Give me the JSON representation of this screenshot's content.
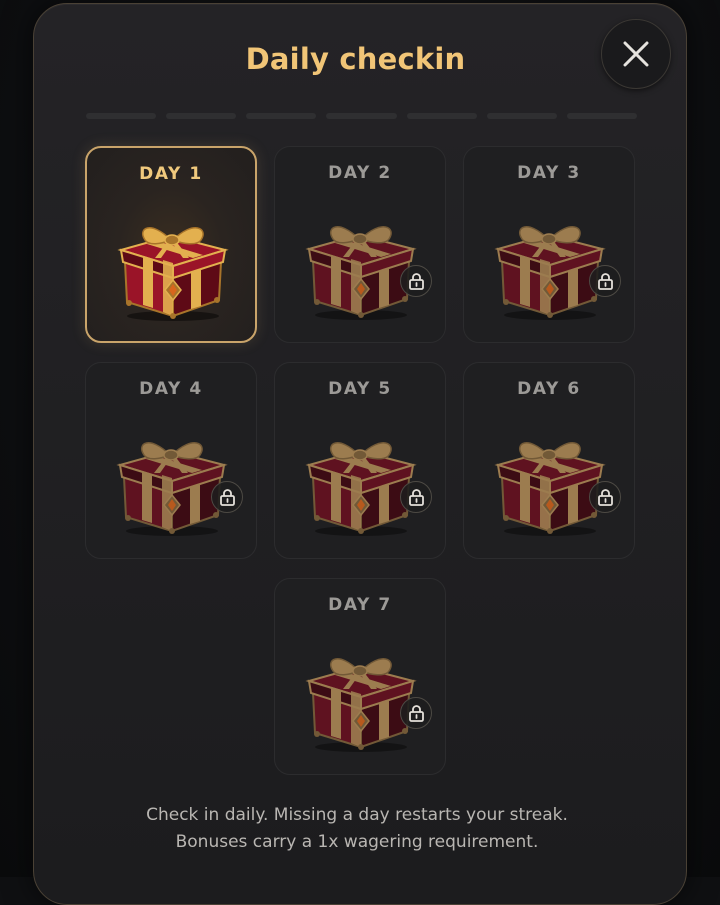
{
  "modal": {
    "title": "Daily checkin",
    "close_icon": "close-icon",
    "progress_segments": 7,
    "days": [
      {
        "label": "DAY 1",
        "state": "available"
      },
      {
        "label": "DAY 2",
        "state": "locked"
      },
      {
        "label": "DAY 3",
        "state": "locked"
      },
      {
        "label": "DAY 4",
        "state": "locked"
      },
      {
        "label": "DAY 5",
        "state": "locked"
      },
      {
        "label": "DAY 6",
        "state": "locked"
      },
      {
        "label": "DAY 7",
        "state": "locked"
      }
    ],
    "footer_line1": "Check in daily. Missing a day restarts your streak.",
    "footer_line2": "Bonuses carry a 1x wagering requirement."
  },
  "colors": {
    "accent_gold": "#f1c577",
    "active_border": "#c9a46a",
    "card_bg": "#1f1f21",
    "gift_red": "#7a1020",
    "gift_gold": "#c9973f"
  }
}
